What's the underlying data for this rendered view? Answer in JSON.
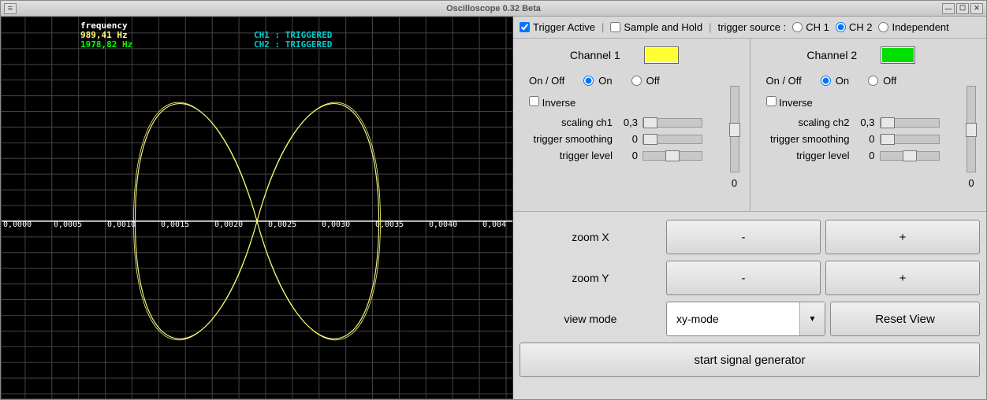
{
  "window": {
    "title": "Oscilloscope 0.32 Beta"
  },
  "scope": {
    "frequency_label": "frequency",
    "freq1": "989,41 Hz",
    "freq2": "1978,82 Hz",
    "ch1_status": "CH1 : TRIGGERED",
    "ch2_status": "CH2 : TRIGGERED",
    "axis_labels": [
      "0,0000",
      "0,0005",
      "0,0010",
      "0,0015",
      "0,0020",
      "0,0025",
      "0,0030",
      "0,0035",
      "0,0040",
      "0,004"
    ]
  },
  "trigger": {
    "active_label": "Trigger Active",
    "active_checked": true,
    "sample_hold_label": "Sample and Hold",
    "sample_hold_checked": false,
    "source_label": "trigger source :",
    "ch1_label": "CH 1",
    "ch2_label": "CH 2",
    "independent_label": "Independent",
    "source_selected": "ch2"
  },
  "channel1": {
    "title": "Channel 1",
    "color": "#ffff33",
    "onoff_label": "On / Off",
    "on_label": "On",
    "off_label": "Off",
    "on": true,
    "inverse_label": "Inverse",
    "inverse": false,
    "scaling_label": "scaling ch1",
    "scaling_val": "0,3",
    "smoothing_label": "trigger smoothing",
    "smoothing_val": "0",
    "trigger_level_label": "trigger level",
    "trigger_level_val": "0",
    "vslider_val": "0"
  },
  "channel2": {
    "title": "Channel 2",
    "color": "#00e000",
    "onoff_label": "On / Off",
    "on_label": "On",
    "off_label": "Off",
    "on": true,
    "inverse_label": "Inverse",
    "inverse": false,
    "scaling_label": "scaling ch2",
    "scaling_val": "0,3",
    "smoothing_label": "trigger smoothing",
    "smoothing_val": "0",
    "trigger_level_label": "trigger level",
    "trigger_level_val": "0",
    "vslider_val": "0"
  },
  "zoom": {
    "x_label": "zoom X",
    "y_label": "zoom Y",
    "minus": "-",
    "plus": "+",
    "view_mode_label": "view mode",
    "view_mode_value": "xy-mode",
    "reset_label": "Reset View",
    "start_label": "start signal generator"
  }
}
